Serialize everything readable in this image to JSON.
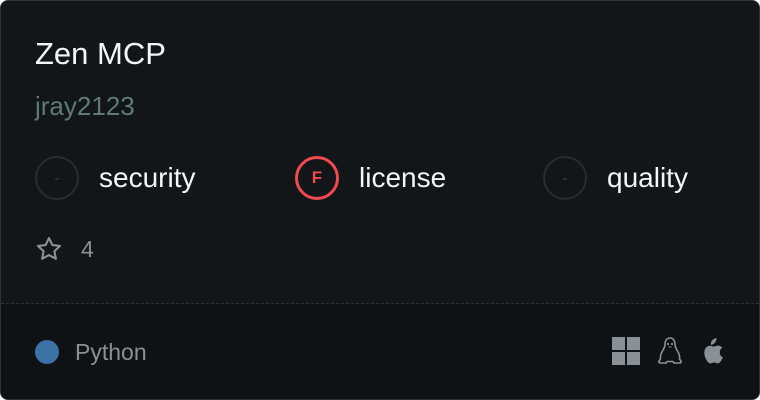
{
  "server": {
    "name": "Zen MCP",
    "author": "jray2123"
  },
  "scores": [
    {
      "label": "security",
      "grade": "-",
      "status": "none"
    },
    {
      "label": "license",
      "grade": "F",
      "status": "fail"
    },
    {
      "label": "quality",
      "grade": "-",
      "status": "none"
    }
  ],
  "stars": {
    "icon": "star-outline-icon",
    "count": "4"
  },
  "language": {
    "name": "Python",
    "color": "#3b72a6"
  },
  "platforms": [
    {
      "icon": "windows-icon"
    },
    {
      "icon": "linux-icon"
    },
    {
      "icon": "apple-icon"
    }
  ],
  "colors": {
    "card_bg": "#121619",
    "footer_bg": "#0e1215",
    "fail": "#f2484f",
    "author": "#5f7a73",
    "muted": "#8a9196"
  }
}
